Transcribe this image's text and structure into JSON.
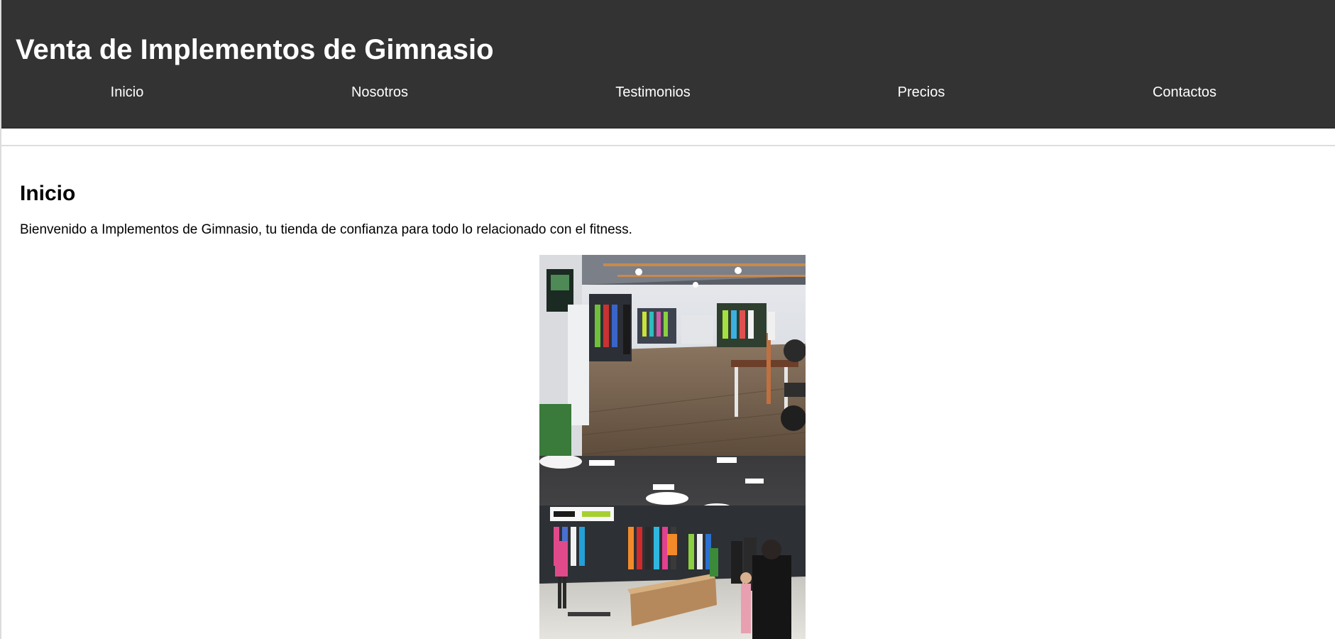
{
  "header": {
    "title": "Venta de Implementos de Gimnasio"
  },
  "nav": {
    "items": [
      {
        "label": "Inicio"
      },
      {
        "label": "Nosotros"
      },
      {
        "label": "Testimonios"
      },
      {
        "label": "Precios"
      },
      {
        "label": "Contactos"
      }
    ]
  },
  "main": {
    "section_title": "Inicio",
    "intro_text": "Bienvenido a Implementos de Gimnasio, tu tienda de confianza para todo lo relacionado con el fitness."
  },
  "colors": {
    "header_bg": "#333333",
    "header_text": "#ffffff",
    "body_text": "#000000"
  }
}
